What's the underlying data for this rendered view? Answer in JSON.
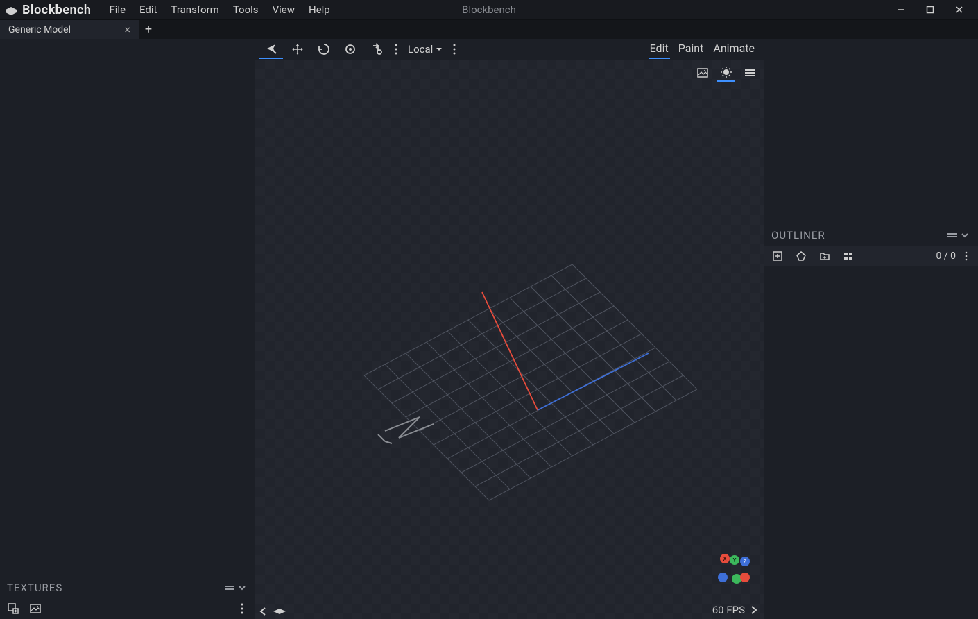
{
  "app": {
    "name": "Blockbench",
    "window_title": "Blockbench"
  },
  "menu": {
    "file": "File",
    "edit": "Edit",
    "transform": "Transform",
    "tools": "Tools",
    "view": "View",
    "help": "Help"
  },
  "tabs": {
    "active": "Generic Model"
  },
  "textures": {
    "title": "TEXTURES"
  },
  "toolbar": {
    "space_dropdown": "Local"
  },
  "modes": {
    "edit": "Edit",
    "paint": "Paint",
    "animate": "Animate"
  },
  "outliner": {
    "title": "OUTLINER",
    "count": "0 / 0"
  },
  "viewport": {
    "axis_x": "X",
    "axis_y": "Y",
    "axis_z": "Z",
    "fps": "60 FPS"
  }
}
